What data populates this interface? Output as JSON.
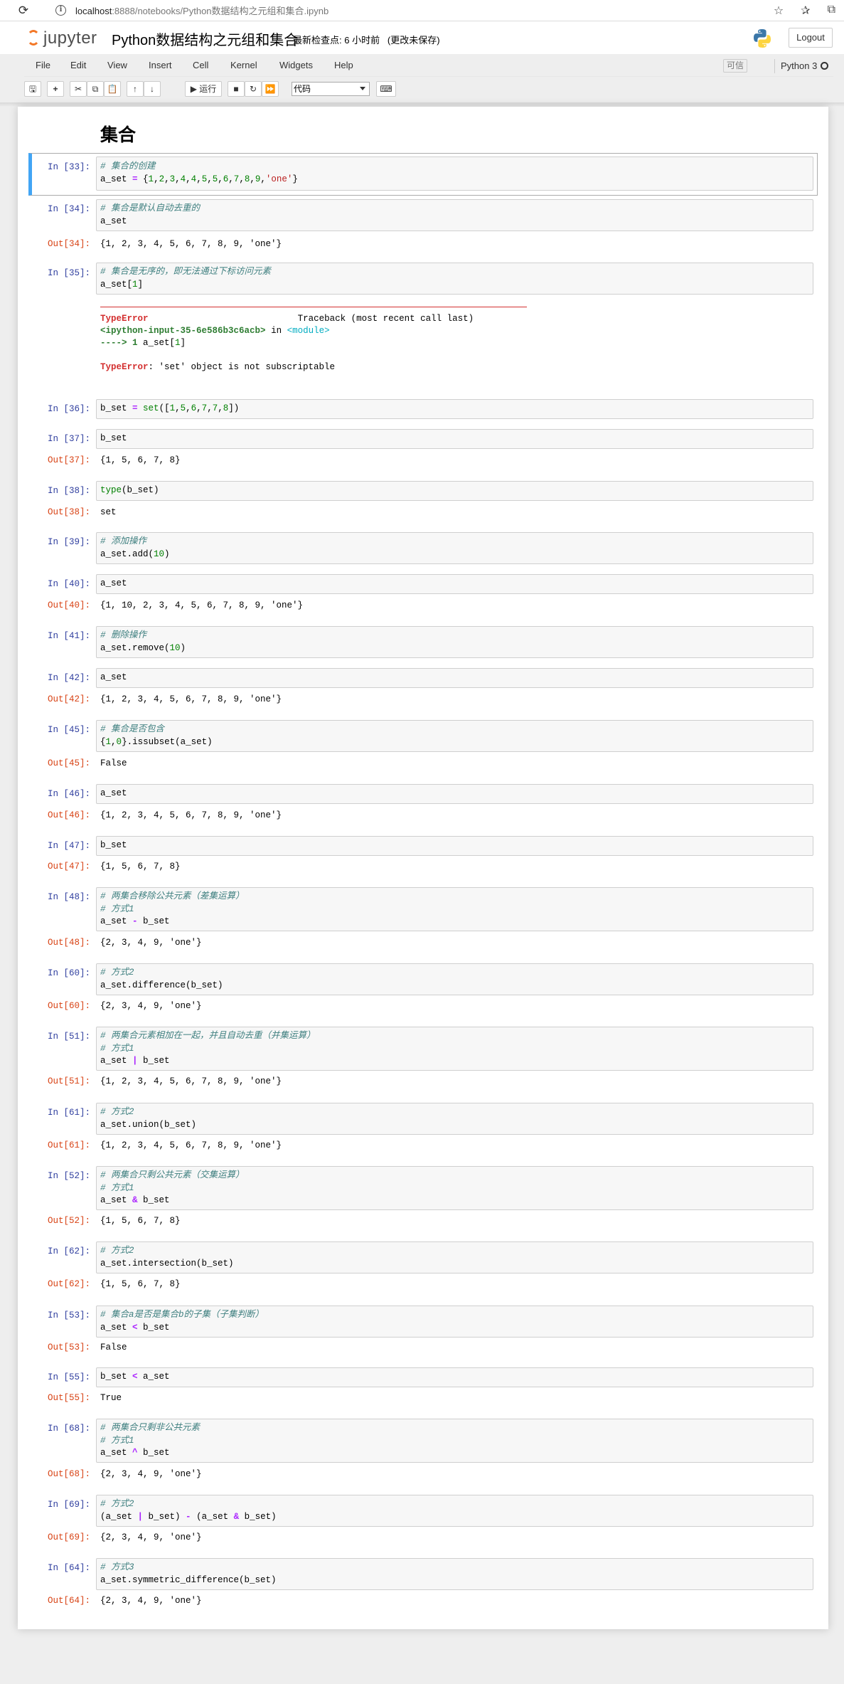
{
  "browser": {
    "url_host": "localhost",
    "url_rest": ":8888/notebooks/Python数据结构之元组和集合.ipynb",
    "reload_icon": "reload-icon",
    "info_icon": "info-icon",
    "icons": [
      "favorites-add-icon",
      "favorites-icon",
      "collections-icon"
    ]
  },
  "header": {
    "logo_text": "jupyter",
    "notebook_title": "Python数据结构之元组和集合",
    "checkpoint": "最新检查点: 6 小时前",
    "unsaved": "(更改未保存)",
    "logout_label": "Logout"
  },
  "menu": {
    "items": [
      "File",
      "Edit",
      "View",
      "Insert",
      "Cell",
      "Kernel",
      "Widgets",
      "Help"
    ],
    "trusted": "可信",
    "kernel_name": "Python 3"
  },
  "toolbar": {
    "run_label": "▶ 运行",
    "cell_type": "代码",
    "icons": [
      "save-icon",
      "add-cell-icon",
      "cut-icon",
      "copy-icon",
      "paste-icon",
      "move-up-icon",
      "move-down-icon",
      "run-icon",
      "stop-icon",
      "restart-icon",
      "fast-forward-icon",
      "keyboard-icon"
    ]
  },
  "colors": {
    "accent_blue": "#42a5f5",
    "prompt_in": "#303f9f",
    "prompt_out": "#d84315",
    "jupyter_orange": "#f37726",
    "error_red": "#d32f2f"
  },
  "notebook": {
    "heading": "集合",
    "cells": [
      {
        "in": "In [33]:",
        "code": [
          "# 集合的创建",
          "a_set = {1,2,3,4,4,5,5,6,7,8,9,'one'}"
        ]
      },
      {
        "in": "In [34]:",
        "code": [
          "# 集合是默认自动去重的",
          "a_set"
        ],
        "out_prompt": "Out[34]:",
        "out": "{1, 2, 3, 4, 5, 6, 7, 8, 9, 'one'}"
      },
      {
        "in": "In [35]:",
        "code": [
          "# 集合是无序的，即无法通过下标访问元素",
          "a_set[1]"
        ],
        "error": {
          "type": "TypeError",
          "traceback_title": "Traceback (most recent call last)",
          "input_ref": "<ipython-input-35-6e586b3c6acb>",
          "in_word": "in",
          "module": "<module>",
          "arrow_line": "----> 1 a_set[1]",
          "message": ": 'set' object is not subscriptable"
        }
      },
      {
        "in": "In [36]:",
        "code": [
          "b_set = set([1,5,6,7,7,8])"
        ]
      },
      {
        "in": "In [37]:",
        "code": [
          "b_set"
        ],
        "out_prompt": "Out[37]:",
        "out": "{1, 5, 6, 7, 8}"
      },
      {
        "in": "In [38]:",
        "code": [
          "type(b_set)"
        ],
        "out_prompt": "Out[38]:",
        "out": "set"
      },
      {
        "in": "In [39]:",
        "code": [
          "# 添加操作",
          "a_set.add(10)"
        ]
      },
      {
        "in": "In [40]:",
        "code": [
          "a_set"
        ],
        "out_prompt": "Out[40]:",
        "out": "{1, 10, 2, 3, 4, 5, 6, 7, 8, 9, 'one'}"
      },
      {
        "in": "In [41]:",
        "code": [
          "# 删除操作",
          "a_set.remove(10)"
        ]
      },
      {
        "in": "In [42]:",
        "code": [
          "a_set"
        ],
        "out_prompt": "Out[42]:",
        "out": "{1, 2, 3, 4, 5, 6, 7, 8, 9, 'one'}"
      },
      {
        "in": "In [45]:",
        "code": [
          "# 集合是否包含",
          "{1,0}.issubset(a_set)"
        ],
        "out_prompt": "Out[45]:",
        "out": "False"
      },
      {
        "in": "In [46]:",
        "code": [
          "a_set"
        ],
        "out_prompt": "Out[46]:",
        "out": "{1, 2, 3, 4, 5, 6, 7, 8, 9, 'one'}"
      },
      {
        "in": "In [47]:",
        "code": [
          "b_set"
        ],
        "out_prompt": "Out[47]:",
        "out": "{1, 5, 6, 7, 8}"
      },
      {
        "in": "In [48]:",
        "code": [
          "# 两集合移除公共元素（差集运算）",
          "# 方式1",
          "a_set - b_set"
        ],
        "out_prompt": "Out[48]:",
        "out": "{2, 3, 4, 9, 'one'}"
      },
      {
        "in": "In [60]:",
        "code": [
          "# 方式2",
          "a_set.difference(b_set)"
        ],
        "out_prompt": "Out[60]:",
        "out": "{2, 3, 4, 9, 'one'}"
      },
      {
        "in": "In [51]:",
        "code": [
          "# 两集合元素相加在一起，并且自动去重（并集运算）",
          "# 方式1",
          "a_set | b_set"
        ],
        "out_prompt": "Out[51]:",
        "out": "{1, 2, 3, 4, 5, 6, 7, 8, 9, 'one'}"
      },
      {
        "in": "In [61]:",
        "code": [
          "# 方式2",
          "a_set.union(b_set)"
        ],
        "out_prompt": "Out[61]:",
        "out": "{1, 2, 3, 4, 5, 6, 7, 8, 9, 'one'}"
      },
      {
        "in": "In [52]:",
        "code": [
          "# 两集合只剩公共元素（交集运算）",
          "# 方式1",
          "a_set & b_set"
        ],
        "out_prompt": "Out[52]:",
        "out": "{1, 5, 6, 7, 8}"
      },
      {
        "in": "In [62]:",
        "code": [
          "# 方式2",
          "a_set.intersection(b_set)"
        ],
        "out_prompt": "Out[62]:",
        "out": "{1, 5, 6, 7, 8}"
      },
      {
        "in": "In [53]:",
        "code": [
          "# 集合a是否是集合b的子集（子集判断）",
          "a_set < b_set"
        ],
        "out_prompt": "Out[53]:",
        "out": "False"
      },
      {
        "in": "In [55]:",
        "code": [
          "b_set < a_set"
        ],
        "out_prompt": "Out[55]:",
        "out": "True"
      },
      {
        "in": "In [68]:",
        "code": [
          "# 两集合只剩非公共元素",
          "# 方式1",
          "a_set ^ b_set"
        ],
        "out_prompt": "Out[68]:",
        "out": "{2, 3, 4, 9, 'one'}"
      },
      {
        "in": "In [69]:",
        "code": [
          "# 方式2",
          "(a_set | b_set) - (a_set & b_set)"
        ],
        "out_prompt": "Out[69]:",
        "out": "{2, 3, 4, 9, 'one'}"
      },
      {
        "in": "In [64]:",
        "code": [
          "# 方式3",
          "a_set.symmetric_difference(b_set)"
        ],
        "out_prompt": "Out[64]:",
        "out": "{2, 3, 4, 9, 'one'}"
      }
    ]
  }
}
